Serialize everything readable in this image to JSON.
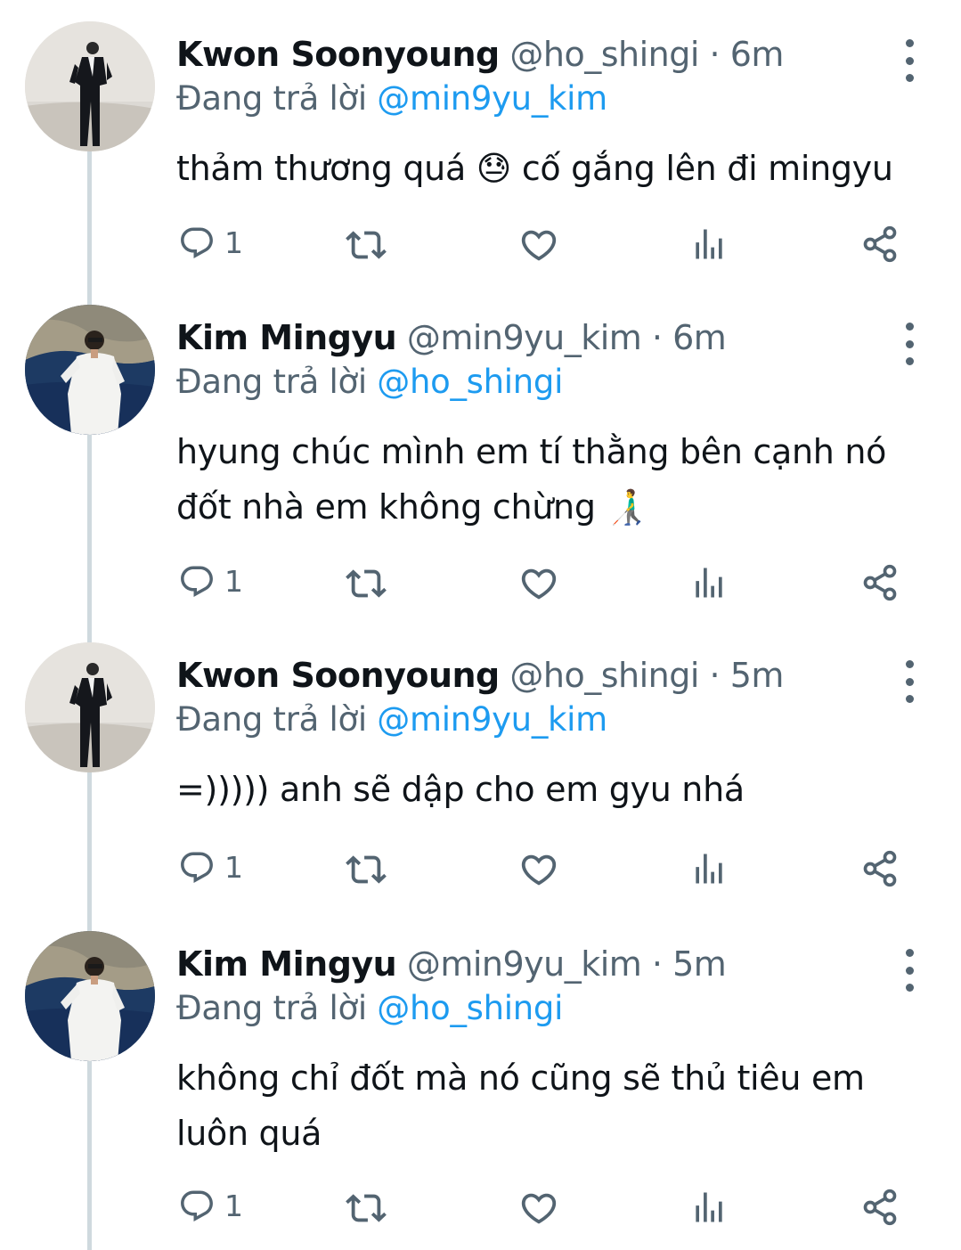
{
  "tweets": [
    {
      "name": "Kwon Soonyoung",
      "handle": "@ho_shingi",
      "separator": "·",
      "time": "6m",
      "reply_prefix": "Đang trả lời",
      "reply_to": "@min9yu_kim",
      "lines": [
        "thảm thương quá 😓 cố gắng lên đi mingyu"
      ],
      "reply_count": "1",
      "avatar": "avatar-suit-photo"
    },
    {
      "name": "Kim Mingyu",
      "handle": "@min9yu_kim",
      "separator": "·",
      "time": "6m",
      "reply_prefix": "Đang trả lời",
      "reply_to": "@ho_shingi",
      "lines": [
        "hyung chúc mình em tí thằng bên cạnh nó",
        "đốt nhà em không chừng 👨‍🦯"
      ],
      "reply_count": "1",
      "avatar": "avatar-sea-photo"
    },
    {
      "name": "Kwon Soonyoung",
      "handle": "@ho_shingi",
      "separator": "·",
      "time": "5m",
      "reply_prefix": "Đang trả lời",
      "reply_to": "@min9yu_kim",
      "lines": [
        "=))))) anh sẽ dập cho em gyu nhá"
      ],
      "reply_count": "1",
      "avatar": "avatar-suit-photo"
    },
    {
      "name": "Kim Mingyu",
      "handle": "@min9yu_kim",
      "separator": "·",
      "time": "5m",
      "reply_prefix": "Đang trả lời",
      "reply_to": "@ho_shingi",
      "lines": [
        "không chỉ đốt mà nó cũng sẽ thủ tiêu em",
        "luôn quá"
      ],
      "reply_count": "1",
      "avatar": "avatar-sea-photo"
    }
  ],
  "colors": {
    "text": "#0f1419",
    "secondary": "#536471",
    "link": "#1d9bf0",
    "thread_line": "#cfd9de"
  },
  "icons": [
    "reply-icon",
    "retweet-icon",
    "like-icon",
    "views-icon",
    "share-icon",
    "more-options-icon"
  ]
}
